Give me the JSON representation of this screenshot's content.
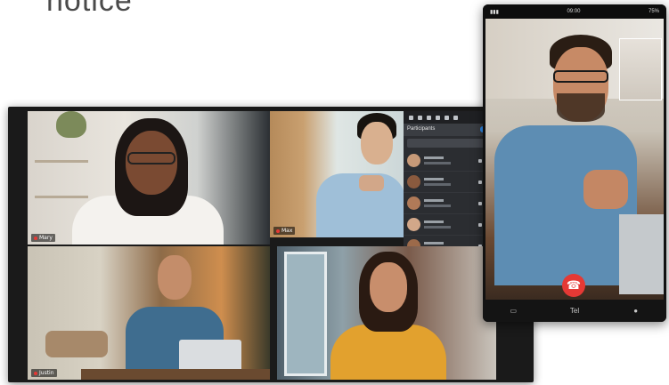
{
  "headline": "notice",
  "desktop": {
    "tiles": [
      {
        "name": "Mary"
      },
      {
        "name": "Max"
      },
      {
        "name": "Justin"
      },
      {
        "name": ""
      }
    ],
    "panel": {
      "title": "Participants",
      "rows": 5
    }
  },
  "phone": {
    "status": {
      "time": "09:00",
      "battery": "75%"
    },
    "bottombar": {
      "left_icon": "chat-icon",
      "center_label": "Tel",
      "right_icon": "mic-icon"
    }
  },
  "colors": {
    "end_call": "#e53935",
    "accent": "#2f8df0"
  }
}
